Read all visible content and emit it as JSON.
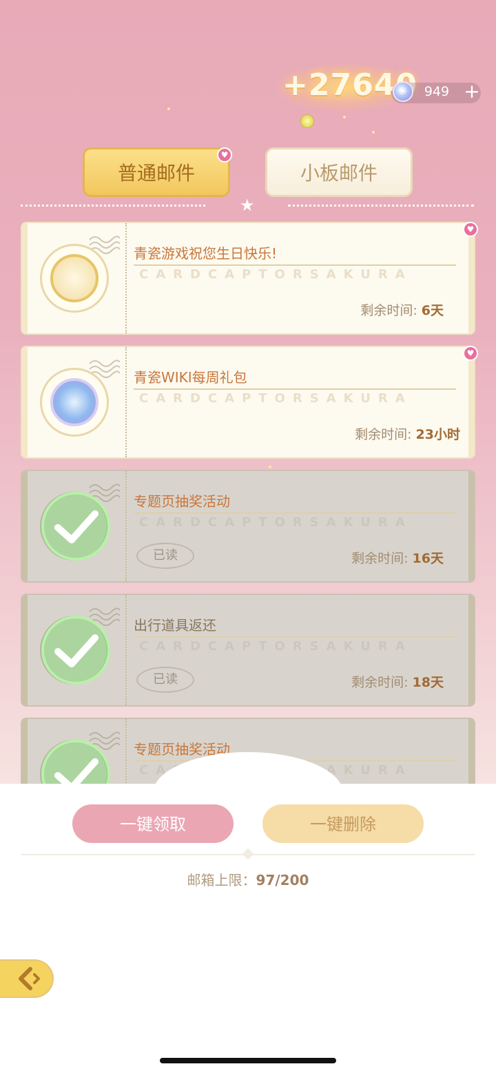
{
  "reward": {
    "amount": "+27640"
  },
  "currency": {
    "value": "949",
    "add_label": "+"
  },
  "tabs": [
    {
      "label": "普通邮件",
      "active": true
    },
    {
      "label": "小板邮件",
      "active": false
    }
  ],
  "mails": [
    {
      "title": "青瓷游戏祝您生日快乐!",
      "watermark": "CARDCAPTORSAKURA",
      "time_label": "剩余时间:",
      "time_value": "6天",
      "read": false
    },
    {
      "title": "青瓷WIKI每周礼包",
      "watermark": "CARDCAPTORSAKURA",
      "time_label": "剩余时间:",
      "time_value": "23小时",
      "read": false
    },
    {
      "title": "专题页抽奖活动",
      "watermark": "CARDCAPTORSAKURA",
      "time_label": "剩余时间:",
      "time_value": "16天",
      "read": true,
      "read_badge": "已读"
    },
    {
      "title": "出行道具返还",
      "watermark": "CARDCAPTORSAKURA",
      "time_label": "剩余时间:",
      "time_value": "18天",
      "read": true,
      "read_badge": "已读"
    },
    {
      "title": "专题页抽奖活动",
      "watermark": "CARDCAPTORSAKURA",
      "read": true
    }
  ],
  "actions": {
    "claim_all": "一键领取",
    "delete_all": "一键删除"
  },
  "mailbox": {
    "limit_label": "邮箱上限：",
    "limit_value": "97/200"
  },
  "icons": {
    "gem": "snowflake-gem-icon",
    "add": "plus-icon",
    "heart": "heart-icon",
    "back": "back-arrow-icon",
    "check": "check-icon"
  },
  "colors": {
    "background_top": "#e8aab7",
    "title_text": "#c8763a",
    "claim_button": "#eba6b3",
    "delete_button": "#f6dca7",
    "heart_badge": "#e8709b"
  }
}
